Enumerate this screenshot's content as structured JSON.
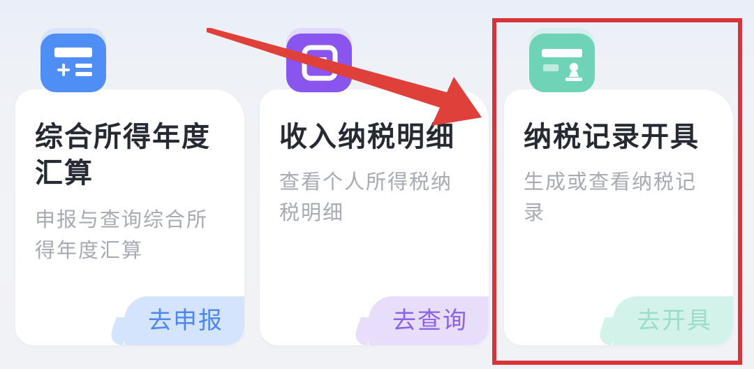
{
  "cards": [
    {
      "title": "综合所得年度汇算",
      "description": "申报与查询综合所得年度汇算",
      "action_label": "去申报",
      "icon": "tax-form-plus-icon",
      "accent": "#4f8ef4"
    },
    {
      "title": "收入纳税明细",
      "description": "查看个人所得税纳税明细",
      "action_label": "去查询",
      "icon": "document-detail-icon",
      "accent": "#8a55ee"
    },
    {
      "title": "纳税记录开具",
      "description": "生成或查看纳税记录",
      "action_label": "去开具",
      "icon": "stamp-record-icon",
      "accent": "#6fd3b7"
    }
  ],
  "annotations": {
    "highlight_color": "#d9333a",
    "arrow_color": "#e0403a"
  }
}
